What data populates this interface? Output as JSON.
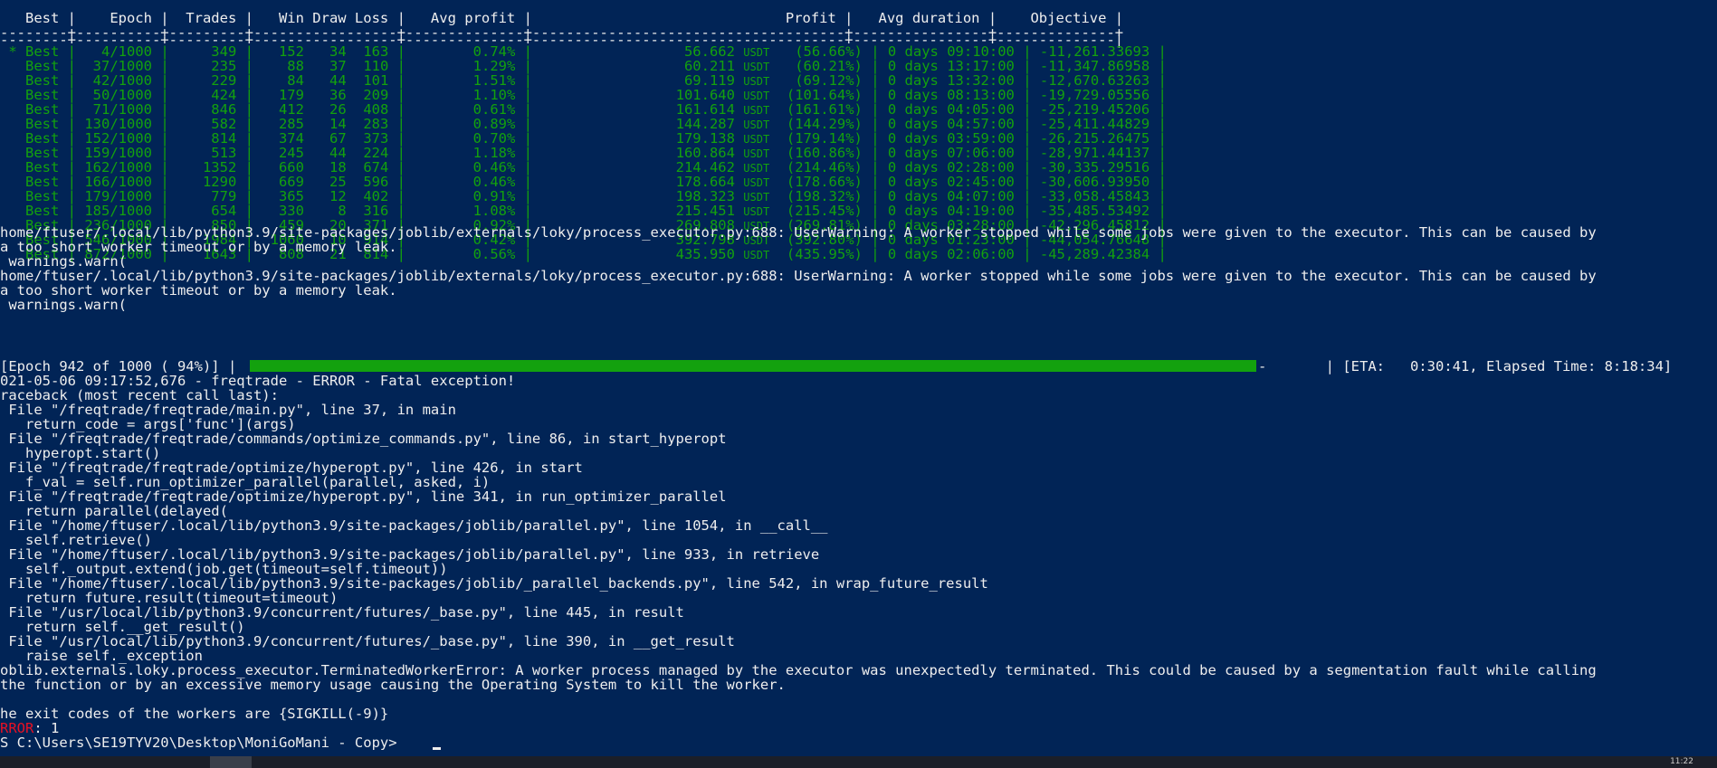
{
  "terminal": {
    "table": {
      "header": "   Best |    Epoch |  Trades |   Win Draw Loss |   Avg profit |                              Profit |   Avg duration |    Objective |",
      "rule_top": "--------+----------+---------+-----------------+--------------+-------------------------------------+----------------+--------------+",
      "rule_bottom": "--------+----------+---------+-----------------+--------------+-------------------------------------+----------------+--------------|",
      "row_prefix_first": " * ",
      "row_prefix": "   ",
      "best_label": "Best",
      "unit": "USDT",
      "duration_prefix": "0 days",
      "rows": [
        {
          "epoch": "4/1000",
          "trades": "349",
          "win": "152",
          "draw": "34",
          "loss": "163",
          "avg_profit": "0.74%",
          "profit": "56.662",
          "profit_pct": "(56.66%)",
          "duration": "09:10:00",
          "objective": "-11,261.33693"
        },
        {
          "epoch": "37/1000",
          "trades": "235",
          "win": "88",
          "draw": "37",
          "loss": "110",
          "avg_profit": "1.29%",
          "profit": "60.211",
          "profit_pct": "(60.21%)",
          "duration": "13:17:00",
          "objective": "-11,347.86958"
        },
        {
          "epoch": "42/1000",
          "trades": "229",
          "win": "84",
          "draw": "44",
          "loss": "101",
          "avg_profit": "1.51%",
          "profit": "69.119",
          "profit_pct": "(69.12%)",
          "duration": "13:32:00",
          "objective": "-12,670.63263"
        },
        {
          "epoch": "50/1000",
          "trades": "424",
          "win": "179",
          "draw": "36",
          "loss": "209",
          "avg_profit": "1.10%",
          "profit": "101.640",
          "profit_pct": "(101.64%)",
          "duration": "08:13:00",
          "objective": "-19,729.05556"
        },
        {
          "epoch": "71/1000",
          "trades": "846",
          "win": "412",
          "draw": "26",
          "loss": "408",
          "avg_profit": "0.61%",
          "profit": "161.614",
          "profit_pct": "(161.61%)",
          "duration": "04:05:00",
          "objective": "-25,219.45206"
        },
        {
          "epoch": "130/1000",
          "trades": "582",
          "win": "285",
          "draw": "14",
          "loss": "283",
          "avg_profit": "0.89%",
          "profit": "144.287",
          "profit_pct": "(144.29%)",
          "duration": "04:57:00",
          "objective": "-25,411.44829"
        },
        {
          "epoch": "152/1000",
          "trades": "814",
          "win": "374",
          "draw": "67",
          "loss": "373",
          "avg_profit": "0.70%",
          "profit": "179.138",
          "profit_pct": "(179.14%)",
          "duration": "03:59:00",
          "objective": "-26,215.26475"
        },
        {
          "epoch": "159/1000",
          "trades": "513",
          "win": "245",
          "draw": "44",
          "loss": "224",
          "avg_profit": "1.18%",
          "profit": "160.864",
          "profit_pct": "(160.86%)",
          "duration": "07:06:00",
          "objective": "-28,971.44137"
        },
        {
          "epoch": "162/1000",
          "trades": "1352",
          "win": "660",
          "draw": "18",
          "loss": "674",
          "avg_profit": "0.46%",
          "profit": "214.462",
          "profit_pct": "(214.46%)",
          "duration": "02:28:00",
          "objective": "-30,335.29516"
        },
        {
          "epoch": "166/1000",
          "trades": "1290",
          "win": "669",
          "draw": "25",
          "loss": "596",
          "avg_profit": "0.46%",
          "profit": "178.664",
          "profit_pct": "(178.66%)",
          "duration": "02:45:00",
          "objective": "-30,606.93950"
        },
        {
          "epoch": "179/1000",
          "trades": "779",
          "win": "365",
          "draw": "12",
          "loss": "402",
          "avg_profit": "0.91%",
          "profit": "198.323",
          "profit_pct": "(198.32%)",
          "duration": "04:07:00",
          "objective": "-33,058.45843"
        },
        {
          "epoch": "185/1000",
          "trades": "654",
          "win": "330",
          "draw": "8",
          "loss": "316",
          "avg_profit": "1.08%",
          "profit": "215.451",
          "profit_pct": "(215.45%)",
          "duration": "04:19:00",
          "objective": "-35,485.53492"
        },
        {
          "epoch": "236/1000",
          "trades": "850",
          "win": "459",
          "draw": "20",
          "loss": "371",
          "avg_profit": "0.92%",
          "profit": "269.808",
          "profit_pct": "(269.81%)",
          "duration": "03:28:00",
          "objective": "-42,296.45812"
        },
        {
          "epoch": "546/1000",
          "trades": "1984",
          "win": "1060",
          "draw": "10",
          "loss": "914",
          "avg_profit": "0.42%",
          "profit": "392.798",
          "profit_pct": "(392.80%)",
          "duration": "01:23:00",
          "objective": "-44,054.76648"
        },
        {
          "epoch": "872/1000",
          "trades": "1643",
          "win": "808",
          "draw": "21",
          "loss": "814",
          "avg_profit": "0.56%",
          "profit": "435.950",
          "profit_pct": "(435.95%)",
          "duration": "02:06:00",
          "objective": "-45,289.42384"
        }
      ]
    },
    "warnings": [
      "home/ftuser/.local/lib/python3.9/site-packages/joblib/externals/loky/process_executor.py:688: UserWarning: A worker stopped while some jobs were given to the executor. This can be caused by",
      "a too short worker timeout or by a memory leak.",
      " warnings.warn(",
      "home/ftuser/.local/lib/python3.9/site-packages/joblib/externals/loky/process_executor.py:688: UserWarning: A worker stopped while some jobs were given to the executor. This can be caused by",
      "a too short worker timeout or by a memory leak.",
      " warnings.warn("
    ],
    "progress": {
      "prefix": "[Epoch 942 of 1000 ( 94%)] |",
      "suffix": "-       | [ETA:   0:30:41, Elapsed Time: 8:18:34]",
      "fraction": 0.94,
      "bar_color": "#13a10e"
    },
    "traceback": [
      "021-05-06 09:17:52,676 - freqtrade - ERROR - Fatal exception!",
      "raceback (most recent call last):",
      " File \"/freqtrade/freqtrade/main.py\", line 37, in main",
      "   return_code = args['func'](args)",
      " File \"/freqtrade/freqtrade/commands/optimize_commands.py\", line 86, in start_hyperopt",
      "   hyperopt.start()",
      " File \"/freqtrade/freqtrade/optimize/hyperopt.py\", line 426, in start",
      "   f_val = self.run_optimizer_parallel(parallel, asked, i)",
      " File \"/freqtrade/freqtrade/optimize/hyperopt.py\", line 341, in run_optimizer_parallel",
      "   return parallel(delayed(",
      " File \"/home/ftuser/.local/lib/python3.9/site-packages/joblib/parallel.py\", line 1054, in __call__",
      "   self.retrieve()",
      " File \"/home/ftuser/.local/lib/python3.9/site-packages/joblib/parallel.py\", line 933, in retrieve",
      "   self._output.extend(job.get(timeout=self.timeout))",
      " File \"/home/ftuser/.local/lib/python3.9/site-packages/joblib/_parallel_backends.py\", line 542, in wrap_future_result",
      "   return future.result(timeout=timeout)",
      " File \"/usr/local/lib/python3.9/concurrent/futures/_base.py\", line 445, in result",
      "   return self.__get_result()",
      " File \"/usr/local/lib/python3.9/concurrent/futures/_base.py\", line 390, in __get_result",
      "   raise self._exception",
      "oblib.externals.loky.process_executor.TerminatedWorkerError: A worker process managed by the executor was unexpectedly terminated. This could be caused by a segmentation fault while calling",
      "the function or by an excessive memory usage causing the Operating System to kill the worker.",
      "",
      "he exit codes of the workers are {SIGKILL(-9)}"
    ],
    "error": {
      "label": "RROR",
      "rest": ": 1"
    },
    "prompt": "S C:\\Users\\SE19TYV20\\Desktop\\MoniGoMani - Copy> "
  },
  "taskbar": {
    "clock": "11:22"
  },
  "colors": {
    "background": "#012456",
    "text": "#eeeeee",
    "green": "#13a10e",
    "red": "#e81123"
  }
}
